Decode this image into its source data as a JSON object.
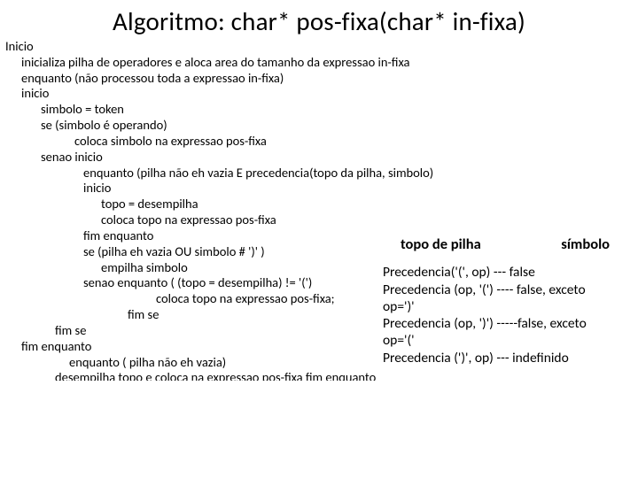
{
  "title": "Algoritmo: char* pos-fixa(char* in-fixa)",
  "lines": {
    "l00": "Inicio",
    "l01": "inicializa pilha de operadores e aloca area do tamanho da expressao in-fixa",
    "l02": "enquanto (não processou toda a expressao in-fixa)",
    "l03": "inicio",
    "l04": "simbolo = token",
    "l05": "se (simbolo é operando)",
    "l06": "coloca simbolo na expressao pos-fixa",
    "l07": "senao inicio",
    "l08": "enquanto (pilha não eh vazia E precedencia(topo da pilha, simbolo)",
    "l09": "inicio",
    "l10": "topo = desempilha",
    "l11": "coloca topo na expressao pos-fixa",
    "l12": "fim enquanto",
    "l13": "se (pilha eh vazia OU simbolo # ')' )",
    "l14": "empilha simbolo",
    "l15": "senao   enquanto ( (topo = desempilha) != '(')",
    "l16": "coloca topo na expressao pos-fixa;",
    "l17": "fim se",
    "l18": "fim se",
    "l19": "fim enquanto",
    "l20": "enquanto ( pilha não eh vazia)",
    "l21": "desempilha topo e coloca na expressao pos-fixa fim enquanto"
  },
  "side": {
    "h1": "topo de pilha",
    "h2": "símbolo",
    "r1": "Precedencia('(', op)  --- false",
    "r2": "Precedencia (op, '(') ---- false, exceto op=')'",
    "r3": "Precedencia (op, ')') -----false, exceto op='('",
    "r4": "Precedencia (')', op) ---  indefinido"
  }
}
